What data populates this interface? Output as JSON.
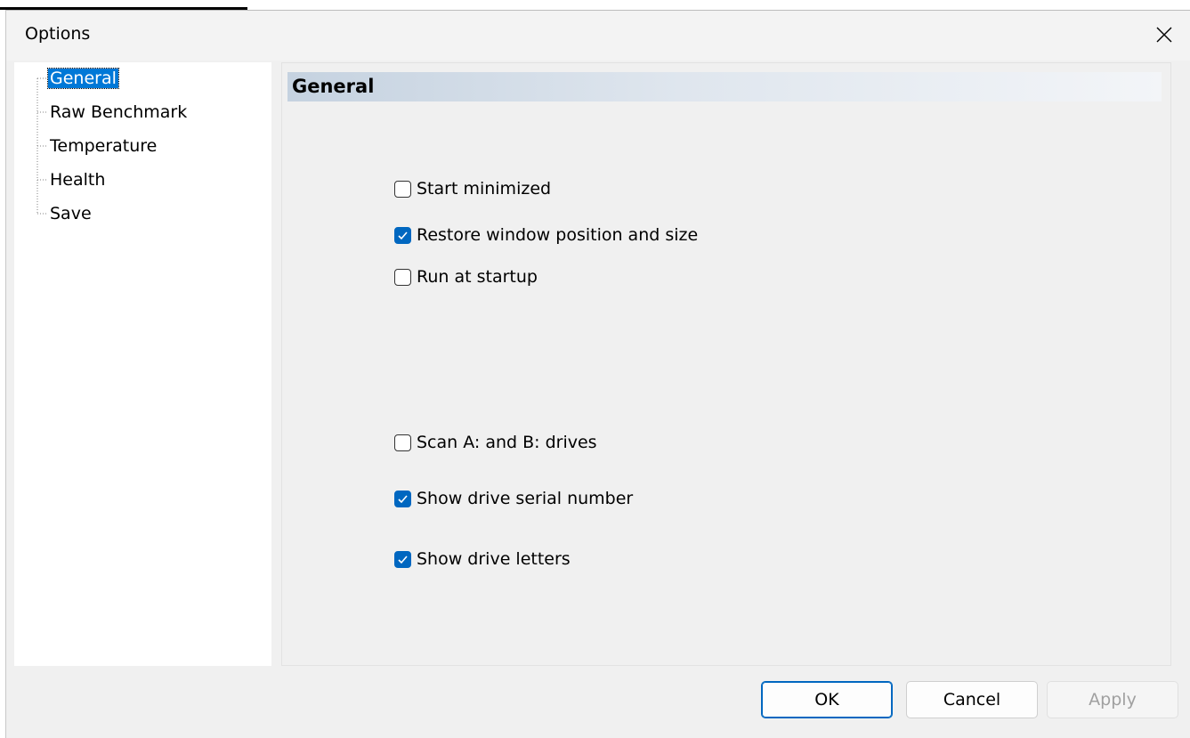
{
  "window": {
    "title": "Options"
  },
  "tree": {
    "items": [
      {
        "label": "General",
        "selected": true
      },
      {
        "label": "Raw Benchmark",
        "selected": false
      },
      {
        "label": "Temperature",
        "selected": false
      },
      {
        "label": "Health",
        "selected": false
      },
      {
        "label": "Save",
        "selected": false
      }
    ]
  },
  "section": {
    "title": "General"
  },
  "options": [
    {
      "label": "Start minimized",
      "checked": false
    },
    {
      "label": "Restore window position and size",
      "checked": true
    },
    {
      "label": "Run at startup",
      "checked": false
    },
    {
      "label": "Scan A: and B: drives",
      "checked": false
    },
    {
      "label": "Show drive serial number",
      "checked": true
    },
    {
      "label": "Show drive letters",
      "checked": true
    }
  ],
  "buttons": {
    "ok": "OK",
    "cancel": "Cancel",
    "apply": "Apply"
  },
  "colors": {
    "accent": "#0067c0",
    "selection": "#0078d7"
  }
}
